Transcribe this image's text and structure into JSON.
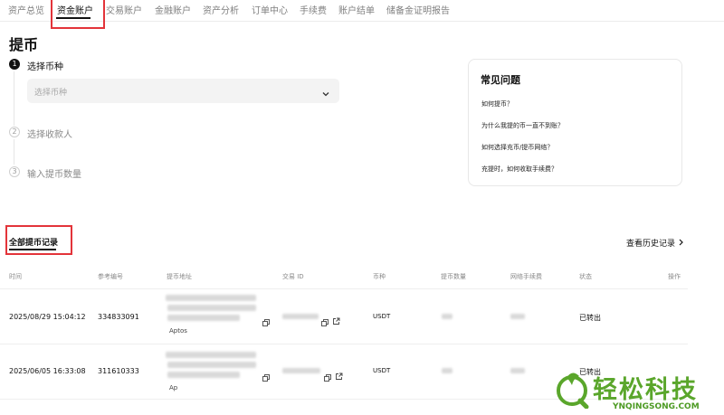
{
  "nav": {
    "tabs": [
      "资产总览",
      "资金账户",
      "交易账户",
      "金融账户",
      "资产分析",
      "订单中心",
      "手续费",
      "账户结单",
      "储备金证明报告"
    ],
    "active_index": 1
  },
  "page": {
    "title": "提币"
  },
  "steps": [
    {
      "num": "1",
      "label": "选择币种"
    },
    {
      "num": "2",
      "label": "选择收款人"
    },
    {
      "num": "3",
      "label": "输入提币数量"
    }
  ],
  "coin_select": {
    "placeholder": "选择币种"
  },
  "faq": {
    "title": "常见问题",
    "questions": [
      "如何提币？",
      "为什么我提的币一直不到账？",
      "如何选择充币/提币网络？",
      "充提时，如何收取手续费？"
    ]
  },
  "records": {
    "title": "全部提币记录",
    "history_link": "查看历史记录",
    "columns": [
      "时间",
      "参考编号",
      "提币地址",
      "交易 ID",
      "币种",
      "提币数量",
      "网络手续费",
      "状态",
      "操作"
    ],
    "rows": [
      {
        "time": "2025/08/29 15:04:12",
        "ref": "334833091",
        "address_network": "Aptos",
        "coin": "USDT",
        "status": "已转出"
      },
      {
        "time": "2025/06/05 16:33:08",
        "ref": "311610333",
        "address_network": "Ap",
        "coin": "USDT",
        "status": "已转出"
      }
    ]
  },
  "watermark": {
    "name": "轻松科技",
    "domain": "YNQINGSONG.COM"
  },
  "colors": {
    "highlight": "#e3343a",
    "watermark": "#5aa62b"
  }
}
